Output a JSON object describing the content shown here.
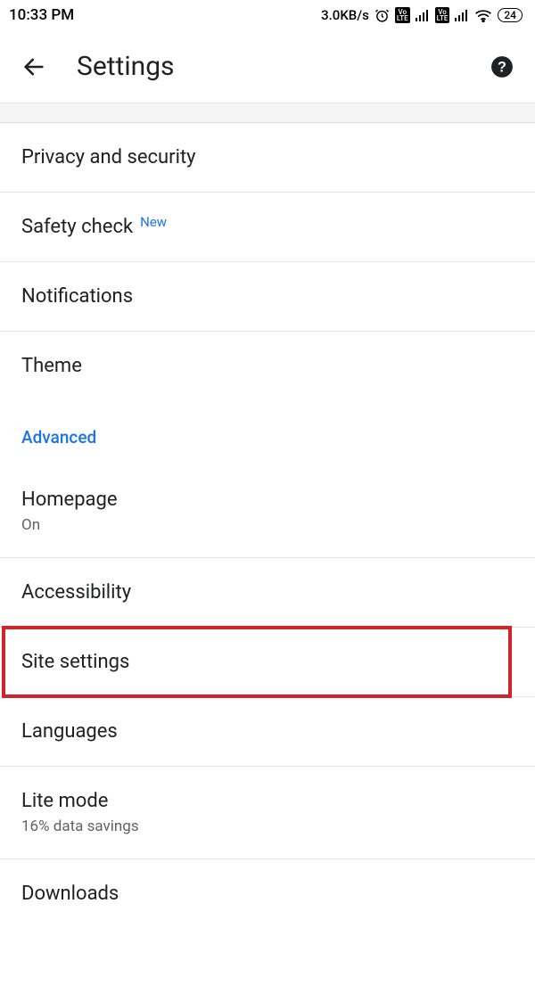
{
  "status": {
    "time": "10:33 PM",
    "speed": "3.0KB/s",
    "battery": "24"
  },
  "header": {
    "title": "Settings"
  },
  "items": {
    "privacy": "Privacy and security",
    "safety": "Safety check",
    "safety_badge": "New",
    "notifications": "Notifications",
    "theme": "Theme",
    "section_advanced": "Advanced",
    "homepage": "Homepage",
    "homepage_sub": "On",
    "accessibility": "Accessibility",
    "site_settings": "Site settings",
    "languages": "Languages",
    "lite_mode": "Lite mode",
    "lite_mode_sub": "16% data savings",
    "downloads": "Downloads"
  }
}
